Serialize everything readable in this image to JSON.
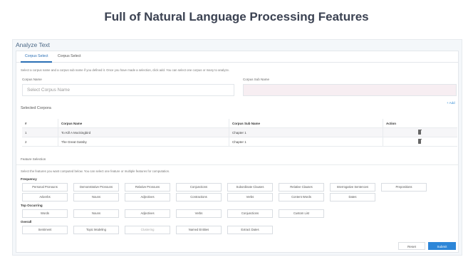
{
  "headline": "Full of Natural Language Processing Features",
  "window": {
    "title": "Analyze Text"
  },
  "tabs": [
    {
      "label": "Corpus Select",
      "active": true
    },
    {
      "label": "Corpus Select",
      "active": false
    }
  ],
  "instructions": "Select a corpus name and a corpus sub name if you defined it. Once you have made a selection, click add. You can select one corpus or many to analyze.",
  "corpus_name": {
    "label": "Corpus Name",
    "placeholder": "Select Corpus Name"
  },
  "corpus_sub_name": {
    "label": "Corpus Sub Name",
    "value": ""
  },
  "add_label": "+ Add",
  "selected": {
    "title": "Selected Corpora",
    "columns": [
      "#",
      "Corpus Name",
      "Corpus Sub Name",
      "Action"
    ],
    "rows": [
      {
        "num": "1",
        "name": "To Kill A Mockingbird",
        "sub": "Chapter 1"
      },
      {
        "num": "2",
        "name": "The Great Gatsby",
        "sub": "Chapter 1"
      }
    ]
  },
  "features": {
    "tab_label": "Feature Selection",
    "instructions": "Select the features you want computed below. You can select one feature or multiple features for computation.",
    "groups": [
      {
        "name": "Frequency",
        "chips": [
          "Personal Pronouns",
          "Demonstrative Pronouns",
          "Relative Pronouns",
          "Conjunctions",
          "Subordinate Clauses",
          "Relative Clauses",
          "Interrogative Sentences",
          "Prepositions",
          "Adverbs",
          "Nouns",
          "Adjectives",
          "Contractions",
          "Verbs",
          "Content Words",
          "Dates"
        ]
      },
      {
        "name": "Top Occurring",
        "chips": [
          "Words",
          "Nouns",
          "Adjectives",
          "Verbs",
          "Conjunctions",
          "Custom List"
        ]
      },
      {
        "name": "Overall",
        "chips": [
          "Sentiment",
          "Topic Modeling",
          "Clustering",
          "Named Entities",
          "Extract Dates"
        ]
      }
    ]
  },
  "buttons": {
    "reset": "Reset",
    "submit": "Submit"
  },
  "colors": {
    "accent": "#2d86d8",
    "tab_active": "#2a6fb5",
    "headline": "#3b4252"
  },
  "icons": {
    "delete": "trash-icon"
  }
}
